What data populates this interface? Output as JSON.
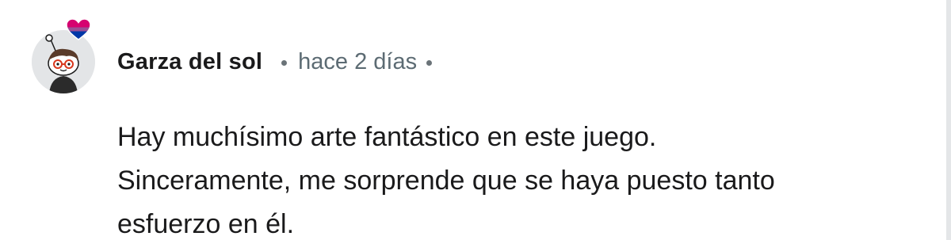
{
  "comment": {
    "author": "Garza del sol",
    "timestamp": "hace 2 días",
    "avatar_icon": "snoo-avatar-icon",
    "flair_icon": "bi-pride-heart-icon",
    "heart_colors": [
      "#d60270",
      "#9b4f96",
      "#0038a8"
    ],
    "body_lines": [
      "Hay muchísimo arte fantástico en este juego.",
      "Sinceramente, me sorprende que se haya puesto tanto",
      "esfuerzo en él."
    ]
  }
}
